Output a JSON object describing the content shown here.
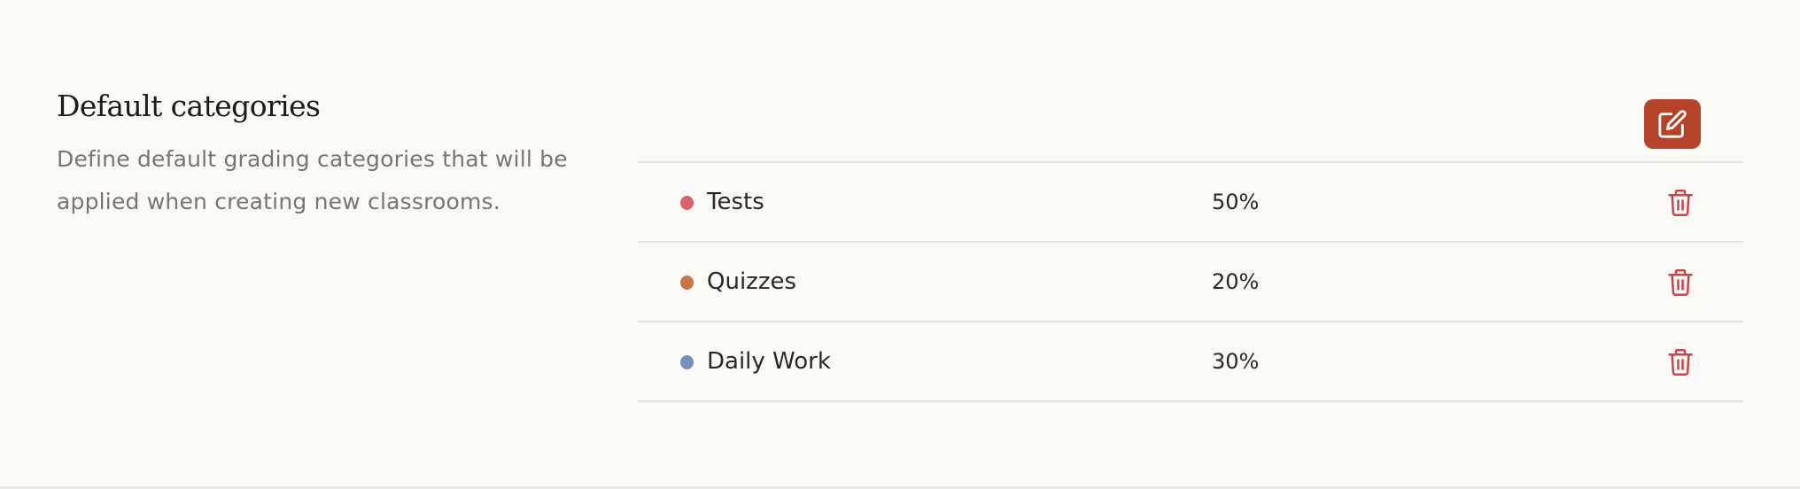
{
  "section": {
    "title": "Default categories",
    "description": "Define default grading categories that will be applied when creating new classrooms."
  },
  "toolbar": {
    "edit_icon": "pencil-square-icon"
  },
  "categories": [
    {
      "name": "Tests",
      "weight": "50%",
      "color": "#d9646a",
      "delete_icon": "trash-icon"
    },
    {
      "name": "Quizzes",
      "weight": "20%",
      "color": "#c7764a",
      "delete_icon": "trash-icon"
    },
    {
      "name": "Daily Work",
      "weight": "30%",
      "color": "#7592b8",
      "delete_icon": "trash-icon"
    }
  ],
  "colors": {
    "accent": "#b5432a",
    "danger": "#c9434b",
    "background": "#faf9f6",
    "muted_text": "#7a746d"
  }
}
